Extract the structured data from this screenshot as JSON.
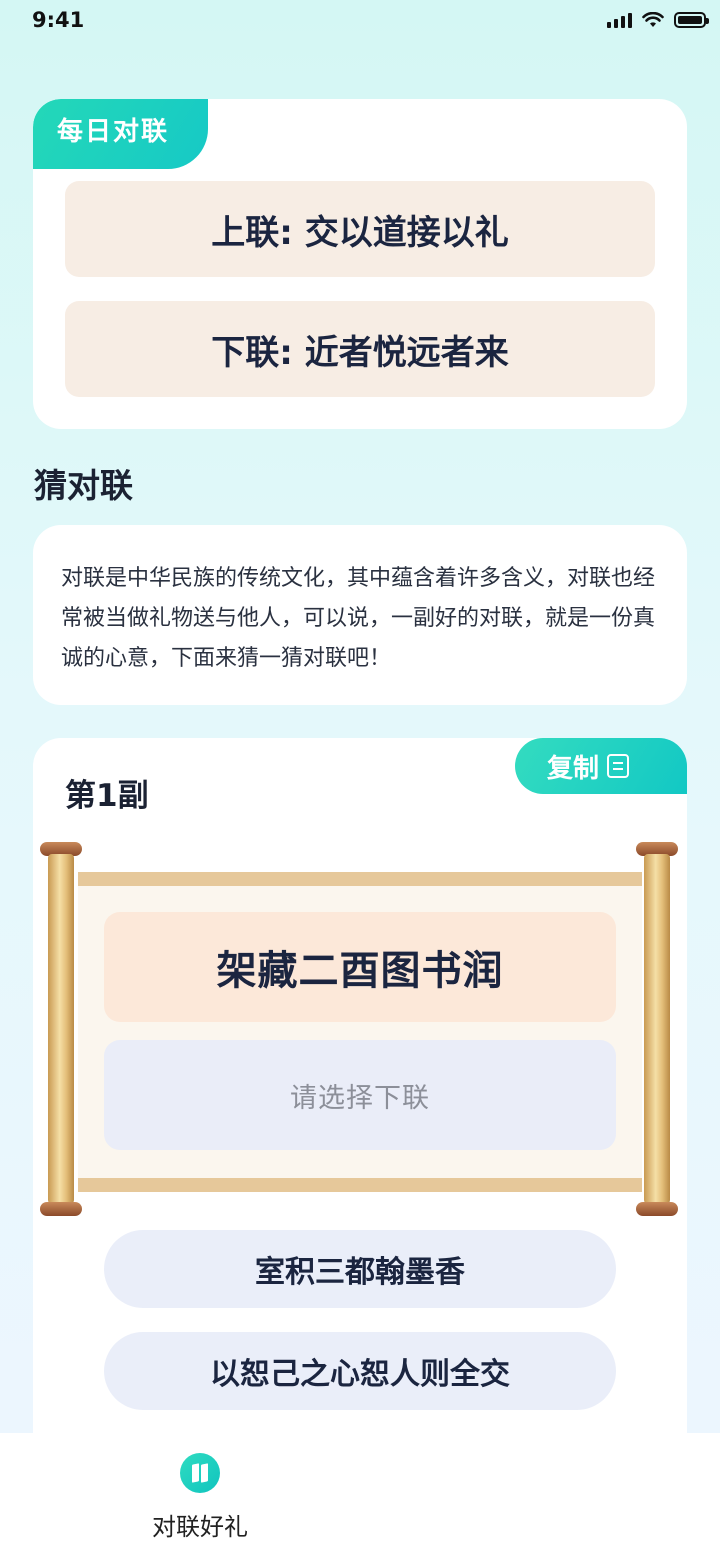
{
  "status_bar": {
    "time": "9:41",
    "signal_icon": "cellular-signal-icon",
    "wifi_icon": "wifi-icon",
    "battery_icon": "battery-icon"
  },
  "daily": {
    "tag": "每日对联",
    "upper": "上联: 交以道接以礼",
    "lower": "下联: 近者悦远者来"
  },
  "guess": {
    "section_title": "猜对联",
    "intro": "对联是中华民族的传统文化，其中蕴含着许多含义，对联也经常被当做礼物送与他人，可以说，一副好的对联，就是一份真诚的心意，下面来猜一猜对联吧！"
  },
  "puzzle": {
    "title": "第1副",
    "copy_label": "复制",
    "copy_icon": "copy-icon",
    "upper_line": "架藏二酉图书润",
    "lower_placeholder": "请选择下联",
    "options": [
      "室积三都翰墨香",
      "以恕己之心恕人则全交"
    ]
  },
  "tab_bar": {
    "items": [
      {
        "label": "对联好礼",
        "icon": "couplet-book-icon",
        "active": true
      }
    ]
  },
  "colors": {
    "accent": "#1cc9be",
    "upper_bg": "#fce8d9",
    "lower_bg": "#eaedf8",
    "scroll_rod": "#e4bf7a"
  }
}
